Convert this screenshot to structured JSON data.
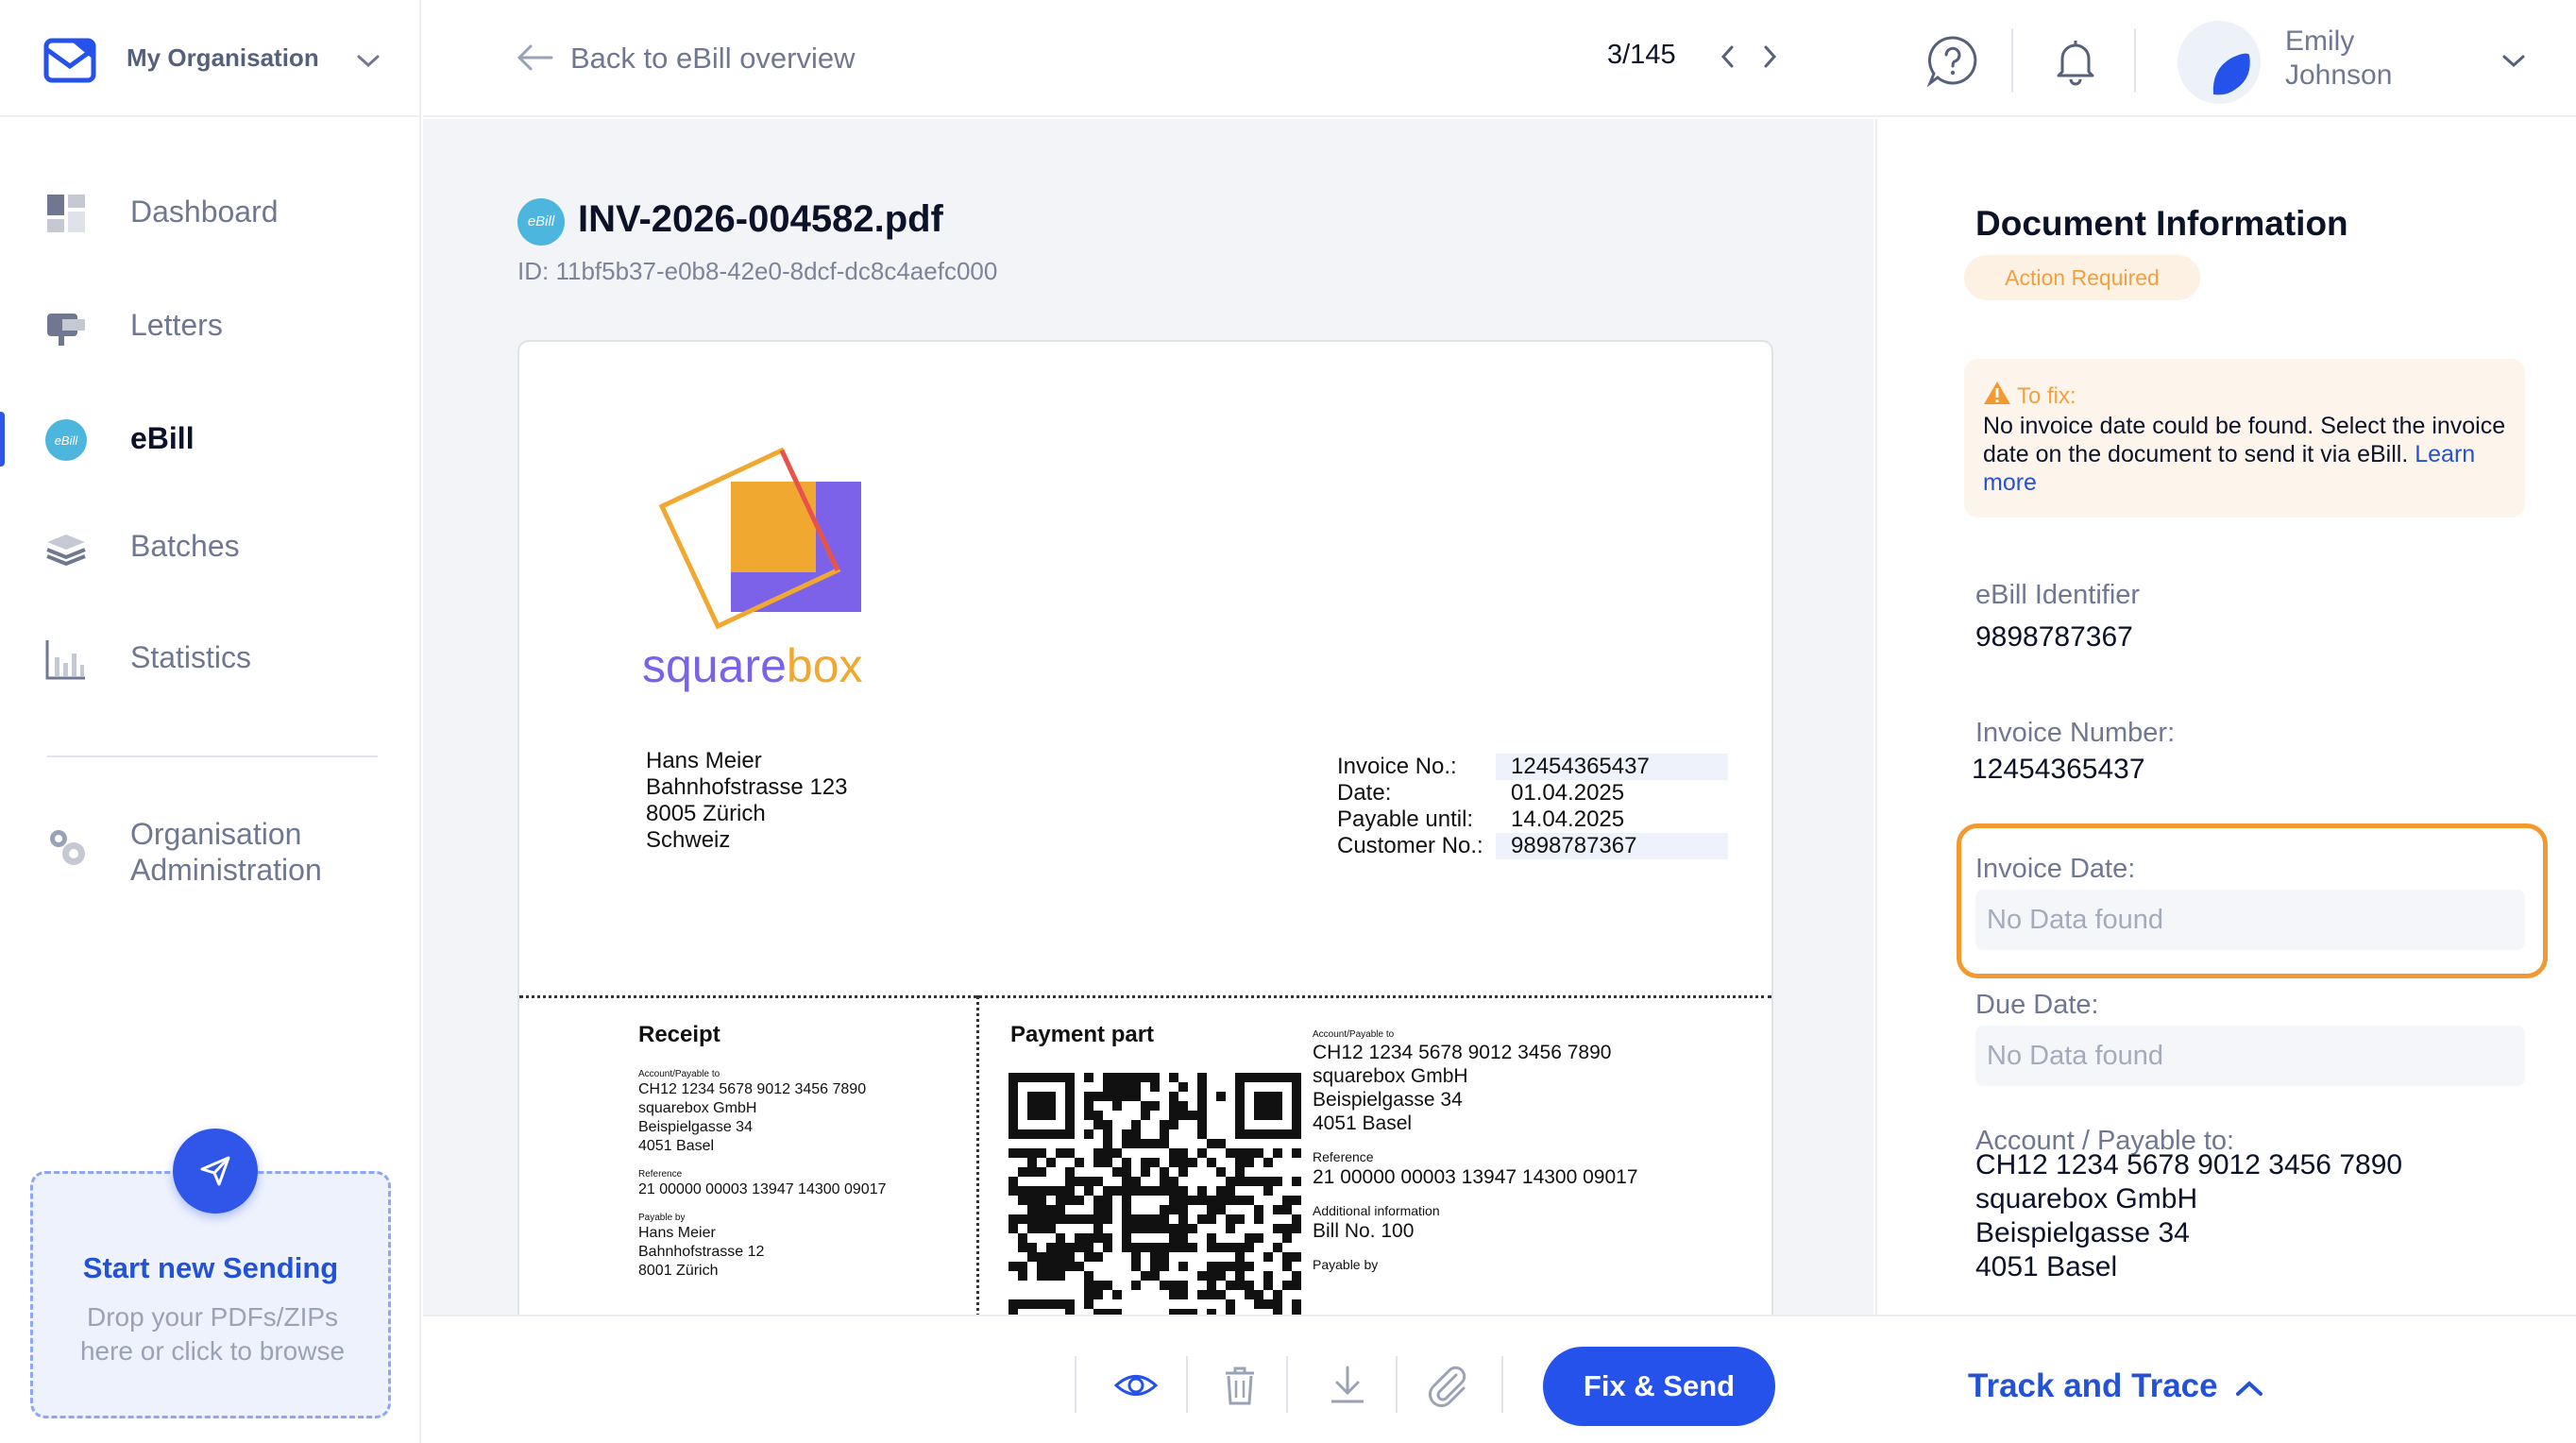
{
  "org": {
    "name": "My Organisation"
  },
  "sidebar": {
    "items": [
      {
        "label": "Dashboard",
        "icon": "dashboard-icon"
      },
      {
        "label": "Letters",
        "icon": "mailbox-icon"
      },
      {
        "label": "eBill",
        "icon": "ebill-icon",
        "active": true
      },
      {
        "label": "Batches",
        "icon": "layers-icon"
      },
      {
        "label": "Statistics",
        "icon": "bar-chart-icon"
      },
      {
        "label": "Organisation\nAdministration",
        "icon": "gears-icon"
      }
    ],
    "upload": {
      "title": "Start new Sending",
      "subtitle": "Drop your PDFs/ZIPs here or click to browse"
    }
  },
  "header": {
    "back_label": "Back to eBill overview",
    "pager": "3/145",
    "user": {
      "first": "Emily",
      "last": "Johnson"
    }
  },
  "document": {
    "badge": "eBill",
    "filename": "INV-2026-004582.pdf",
    "id_line": "ID: 11bf5b37-e0b8-42e0-8dcf-dc8c4aefc000",
    "brand_a": "square",
    "brand_b": "box",
    "recipient": [
      "Hans Meier",
      "Bahnhofstrasse 123",
      "8005 Zürich",
      "Schweiz"
    ],
    "invoice_meta": [
      {
        "k": "Invoice No.:",
        "v": "12454365437",
        "hl": true
      },
      {
        "k": "Date:",
        "v": "01.04.2025",
        "hl": false
      },
      {
        "k": "Payable until:",
        "v": "14.04.2025",
        "hl": false
      },
      {
        "k": "Customer No.:",
        "v": "9898787367",
        "hl": true
      }
    ],
    "receipt": {
      "title": "Receipt",
      "account_label": "Account/Payable to",
      "account_lines": [
        "CH12 1234 5678 9012 3456 7890",
        "squarebox GmbH",
        "Beispielgasse 34",
        "4051 Basel"
      ],
      "reference_label": "Reference",
      "reference": "21 00000 00003 13947 14300 09017",
      "payable_by_label": "Payable by",
      "payable_by_lines": [
        "Hans Meier",
        "Bahnhofstrasse 12",
        "8001 Zürich"
      ]
    },
    "payment": {
      "title": "Payment part",
      "account_label": "Account/Payable to",
      "account_lines": [
        "CH12 1234 5678 9012 3456 7890",
        "squarebox GmbH",
        "Beispielgasse 34",
        "4051 Basel"
      ],
      "reference_label": "Reference",
      "reference": "21 00000 00003 13947 14300 09017",
      "additional_label": "Additional information",
      "additional": "Bill No. 100",
      "payable_by_label": "Payable by"
    }
  },
  "panel": {
    "title": "Document Information",
    "status": "Action Required",
    "fix": {
      "title": "To fix:",
      "text": "No invoice date could be found. Select the invoice date on the document to send it via eBill.",
      "link": "Learn more"
    },
    "fields": {
      "ebill_identifier_label": "eBill Identifier",
      "ebill_identifier": "9898787367",
      "invoice_number_label": "Invoice Number:",
      "invoice_number": "12454365437",
      "invoice_date_label": "Invoice Date:",
      "invoice_date_placeholder": "No Data found",
      "due_date_label": "Due Date:",
      "due_date_placeholder": "No Data found",
      "account_label": "Account / Payable to:",
      "account_lines": [
        "CH12 1234 5678 9012 3456 7890",
        "squarebox GmbH",
        "Beispielgasse 34",
        "4051 Basel"
      ]
    }
  },
  "toolbar": {
    "icons": [
      "eye-icon",
      "trash-icon",
      "download-icon",
      "paperclip-icon"
    ],
    "primary": "Fix & Send",
    "track": "Track and Trace"
  },
  "colors": {
    "accent": "#2452ea",
    "warning": "#f29a30",
    "ebill": "#4db6de",
    "brand_purple": "#7c62e8",
    "brand_orange": "#f0a830"
  }
}
